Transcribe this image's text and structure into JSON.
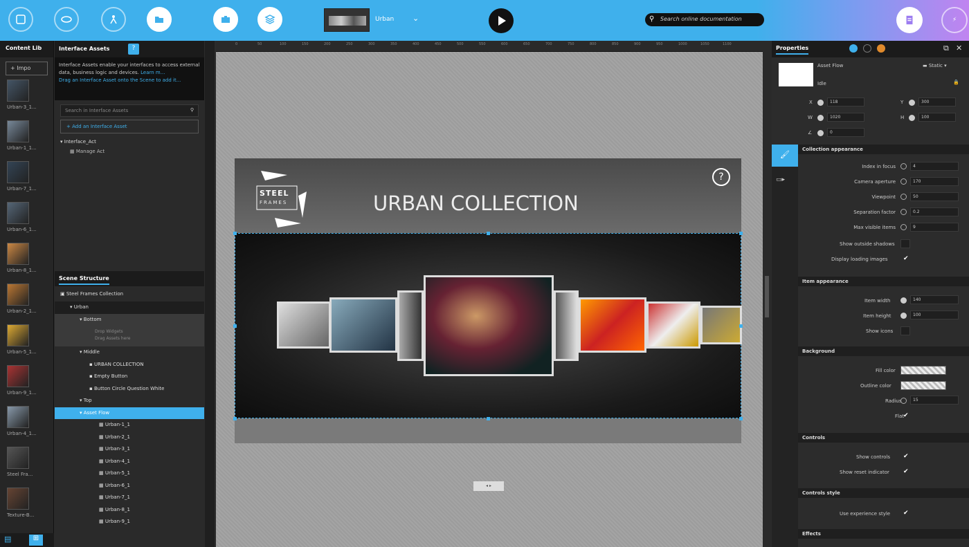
{
  "topbar": {
    "project_name": "Urban",
    "search_placeholder": "Search online documentation",
    "tool_icons": [
      "page-icon",
      "scene-icon",
      "interaction-icon",
      "folder-icon",
      "briefcase-icon",
      "layers-icon"
    ],
    "accent": "#3fb0ec"
  },
  "library": {
    "tab": "Content Lib",
    "import_label": "+ Impo",
    "items": [
      {
        "label": "Urban-3_1..."
      },
      {
        "label": "Urban-1_1..."
      },
      {
        "label": "Urban-7_1..."
      },
      {
        "label": "Urban-6_1..."
      },
      {
        "label": "Urban-8_1..."
      },
      {
        "label": "Urban-2_1..."
      },
      {
        "label": "Urban-5_1..."
      },
      {
        "label": "Urban-9_1..."
      },
      {
        "label": "Urban-4_1..."
      },
      {
        "label": "Steel Fra..."
      },
      {
        "label": "Texture-B..."
      }
    ]
  },
  "interface_assets": {
    "tab": "Interface Assets",
    "desc": "Interface Assets enable your interfaces to access external data, business logic and devices.",
    "learn_more": "Learn m...",
    "drag_hint": "Drag an Interface Asset onto the Scene to add it...",
    "search_placeholder": "Search in Interface Assets",
    "add_label": "+ Add an Interface Asset",
    "group": "Interface_Act",
    "group_item": "Manage Act"
  },
  "scene": {
    "tab": "Scene Structure",
    "root": "Steel Frames Collection",
    "rows": [
      {
        "label": "Urban",
        "indent": 1,
        "style": "dark"
      },
      {
        "label": "Bottom",
        "indent": 2,
        "style": "grey"
      },
      {
        "label": "Middle",
        "indent": 2,
        "style": "plain"
      },
      {
        "label": "URBAN COLLECTION",
        "indent": 3,
        "style": "plain"
      },
      {
        "label": "Empty Button",
        "indent": 3,
        "style": "plain"
      },
      {
        "label": "Button Circle Question White",
        "indent": 3,
        "style": "plain"
      },
      {
        "label": "Top",
        "indent": 2,
        "style": "plain"
      },
      {
        "label": "Asset Flow",
        "indent": 2,
        "style": "sel"
      },
      {
        "label": "Urban-1_1",
        "indent": 4,
        "style": "plain"
      },
      {
        "label": "Urban-2_1",
        "indent": 4,
        "style": "plain"
      },
      {
        "label": "Urban-3_1",
        "indent": 4,
        "style": "plain"
      },
      {
        "label": "Urban-4_1",
        "indent": 4,
        "style": "plain"
      },
      {
        "label": "Urban-5_1",
        "indent": 4,
        "style": "plain"
      },
      {
        "label": "Urban-6_1",
        "indent": 4,
        "style": "plain"
      },
      {
        "label": "Urban-7_1",
        "indent": 4,
        "style": "plain"
      },
      {
        "label": "Urban-8_1",
        "indent": 4,
        "style": "plain"
      },
      {
        "label": "Urban-9_1",
        "indent": 4,
        "style": "plain"
      }
    ],
    "drop_hint_1": "Drop Widgets",
    "drop_hint_2": "Drag Assets here"
  },
  "ruler": {
    "ticks": [
      "0",
      "50",
      "100",
      "150",
      "200",
      "250",
      "300",
      "350",
      "400",
      "450",
      "500",
      "550",
      "600",
      "650",
      "700",
      "750",
      "800",
      "850",
      "900",
      "950",
      "1000",
      "1050",
      "1100"
    ]
  },
  "stage": {
    "logo_line1": "STEEL",
    "logo_line2": "FRAMES",
    "headline": "URBAN COLLECTION",
    "help": "?"
  },
  "properties": {
    "tab": "Properties",
    "asset_name": "Asset Flow",
    "state": "Static",
    "name_field": "Idle",
    "x": "118",
    "y": "300",
    "w": "1020",
    "h": "100",
    "angle": "0",
    "sections": {
      "collection": "Collection appearance",
      "item": "Item appearance",
      "background": "Background",
      "controls": "Controls",
      "controls_style": "Controls style",
      "effects": "Effects"
    },
    "collection_fields": [
      {
        "label": "Index in focus",
        "value": "4"
      },
      {
        "label": "Camera aperture",
        "value": "170"
      },
      {
        "label": "Viewpoint",
        "value": "50"
      },
      {
        "label": "Separation factor",
        "value": "0.2"
      },
      {
        "label": "Max visible items",
        "value": "9"
      }
    ],
    "show_outside_shadows": "Show outside shadows",
    "display_loading_images": "Display loading images",
    "item_width_label": "Item width",
    "item_width": "140",
    "item_height_label": "Item height",
    "item_height": "100",
    "show_icons": "Show icons",
    "fill_color_label": "Fill color",
    "outline_color_label": "Outline color",
    "radius_label": "Radius",
    "radius": "15",
    "flat_label": "Flat",
    "show_controls": "Show controls",
    "show_reset": "Show reset indicator",
    "use_experience_style": "Use experience style"
  }
}
